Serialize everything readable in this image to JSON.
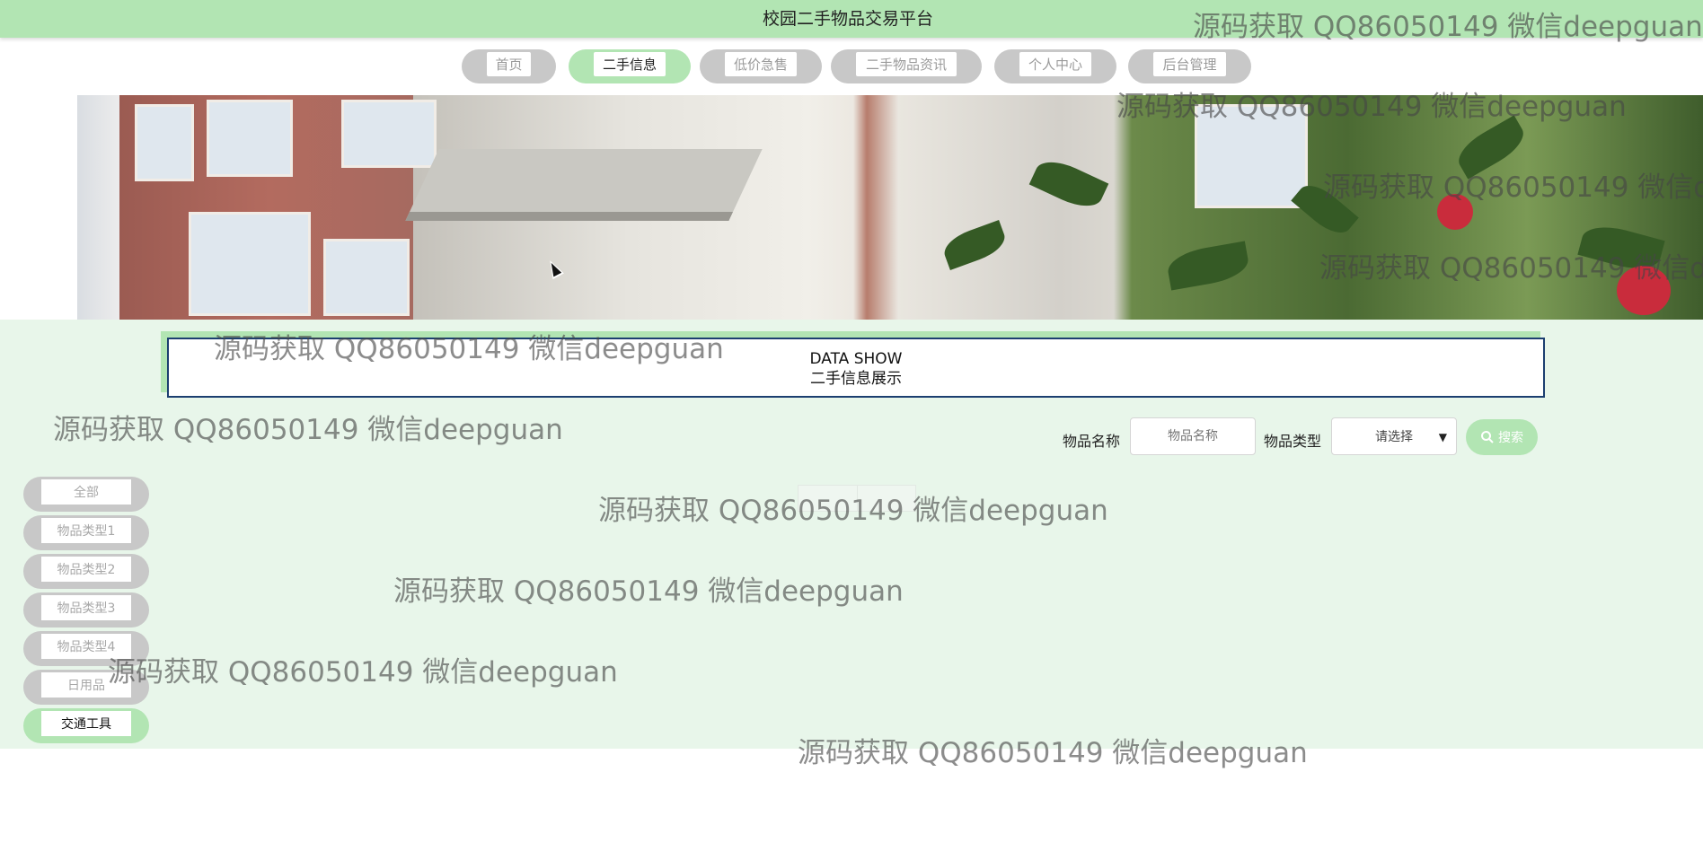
{
  "site": {
    "title": "校园二手物品交易平台"
  },
  "nav": {
    "items": [
      {
        "label": "首页"
      },
      {
        "label": "二手信息"
      },
      {
        "label": "低价急售"
      },
      {
        "label": "二手物品资讯"
      },
      {
        "label": "个人中心"
      },
      {
        "label": "后台管理"
      }
    ],
    "active_index": 1
  },
  "section": {
    "en": "DATA SHOW",
    "cn": "二手信息展示"
  },
  "search": {
    "name_label": "物品名称",
    "name_placeholder": "物品名称",
    "type_label": "物品类型",
    "type_selected": "请选择",
    "button_label": "搜索"
  },
  "categories": {
    "items": [
      {
        "label": "全部"
      },
      {
        "label": "物品类型1"
      },
      {
        "label": "物品类型2"
      },
      {
        "label": "物品类型3"
      },
      {
        "label": "物品类型4"
      },
      {
        "label": "日用品"
      },
      {
        "label": "交通工具"
      }
    ],
    "active_index": 6
  },
  "watermark": {
    "text": "源码获取 QQ86050149 微信deepguan"
  },
  "colors": {
    "accent_green": "#b2e5b3",
    "content_bg": "#e8f6ea",
    "section_border": "#1c3f70"
  }
}
